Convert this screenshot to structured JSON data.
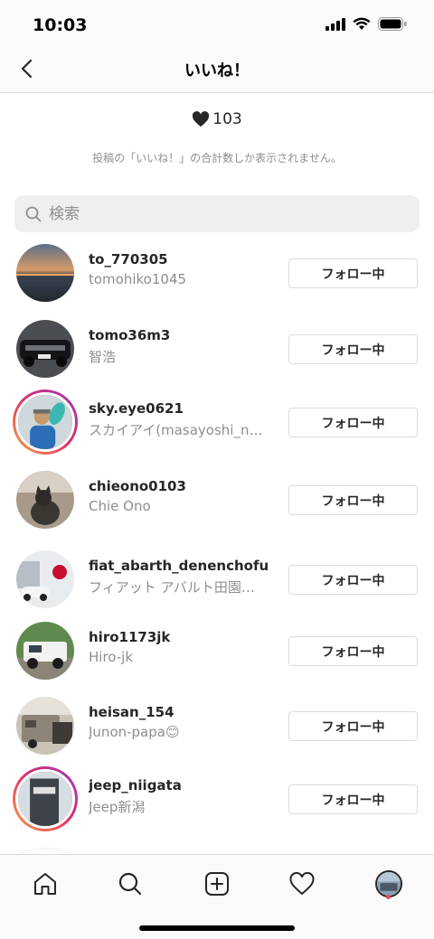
{
  "status_bar": {
    "time": "10:03"
  },
  "header": {
    "title": "いいね！"
  },
  "likes": {
    "count": "103",
    "note": "投稿の「いいね！」の合計数しか表示されません。"
  },
  "search": {
    "placeholder": "検索"
  },
  "follow_label": "フォロー中",
  "users": [
    {
      "username": "to_770305",
      "fullname": "tomohiko1045",
      "story_ring": false
    },
    {
      "username": "tomo36m3",
      "fullname": "智浩",
      "story_ring": false
    },
    {
      "username": "sky.eye0621",
      "fullname": "スカイアイ(masayoshi_n…",
      "story_ring": true
    },
    {
      "username": "chieono0103",
      "fullname": "Chie  Ono",
      "story_ring": false
    },
    {
      "username": "fiat_abarth_denenchofu",
      "fullname": "フィアット アバルト田園…",
      "story_ring": false
    },
    {
      "username": "hiro1173jk",
      "fullname": "Hiro-jk",
      "story_ring": false
    },
    {
      "username": "heisan_154",
      "fullname": "Junon-papa😊",
      "story_ring": false
    },
    {
      "username": "jeep_niigata",
      "fullname": "Jeep新潟",
      "story_ring": true
    }
  ],
  "colors": {
    "accent_ring_start": "#f9a33f",
    "accent_ring_end": "#9b36b7",
    "notification_dot": "#ed4956"
  },
  "icons": [
    "back-chevron-icon",
    "heart-icon",
    "search-icon",
    "home-icon",
    "explore-icon",
    "new-post-icon",
    "activity-heart-icon",
    "profile-avatar-icon"
  ]
}
